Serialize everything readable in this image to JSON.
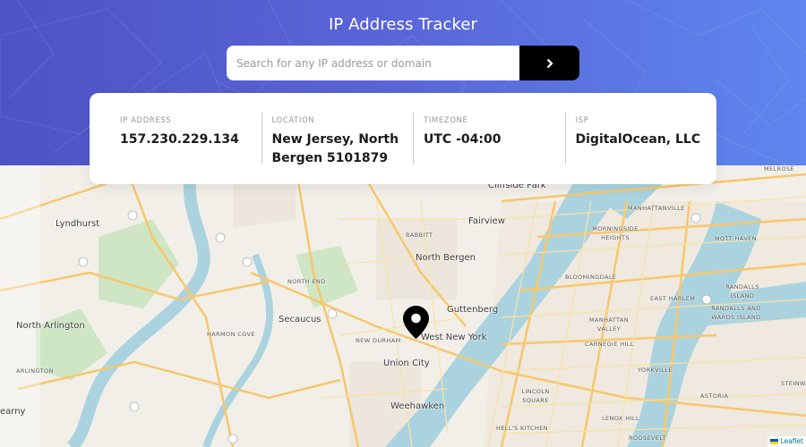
{
  "header": {
    "title": "IP Address Tracker",
    "background_colors": [
      "#4d53c4",
      "#5e86ee"
    ]
  },
  "search": {
    "placeholder": "Search for any IP address or domain",
    "value": "",
    "button_icon": "chevron-right-icon"
  },
  "info": {
    "ip": {
      "label": "IP Address",
      "value": "157.230.229.134"
    },
    "location": {
      "label": "Location",
      "value": "New Jersey, North Bergen 5101879"
    },
    "timezone": {
      "label": "Timezone",
      "value": "UTC -04:00"
    },
    "isp": {
      "label": "ISP",
      "value": "DigitalOcean, LLC"
    }
  },
  "map": {
    "marker_icon": "map-pin-icon",
    "attribution": "Leaflet",
    "labels": {
      "lyndhurst": "Lyndhurst",
      "north_arlington": "North Arlington",
      "arlington": "ARLINGTON",
      "kearny": "earny",
      "secaucus": "Secaucus",
      "harmon_cove": "HARMON COVE",
      "north_end": "NORTH END",
      "north_bergen": "North Bergen",
      "babbitt": "BABBITT",
      "fairview": "Fairview",
      "cliffside_park": "Cliffside Park",
      "guttenberg": "Guttenberg",
      "west_new_york": "West New York",
      "new_durham": "NEW DURHAM",
      "union_city": "Union City",
      "weehawken": "Weehawken",
      "manhattanville": "MANHATTANVILLE",
      "morningside_heights": "MORNINGSIDE HEIGHTS",
      "mott_haven": "MOTT HAVEN",
      "melrose": "MELROSE",
      "randalls_island": "RANDALLS ISLAND",
      "wards_island": "RANDALLS AND WARDS ISLAND",
      "bloomingdale": "BLOOMINGDALE",
      "east_harlem": "EAST HARLEM",
      "manhattan_valley": "MANHATTAN VALLEY",
      "carnegie_hill": "CARNEGIE HILL",
      "yorkville": "YORKVILLE",
      "astoria": "ASTORIA",
      "lincoln_square": "LINCOLN SQUARE",
      "hells_kitchen": "HELL'S KITCHEN",
      "lenox_hill": "LENOX HILL",
      "roosevelt": "ROOSEVELT",
      "steinway": "STEINWA"
    }
  }
}
